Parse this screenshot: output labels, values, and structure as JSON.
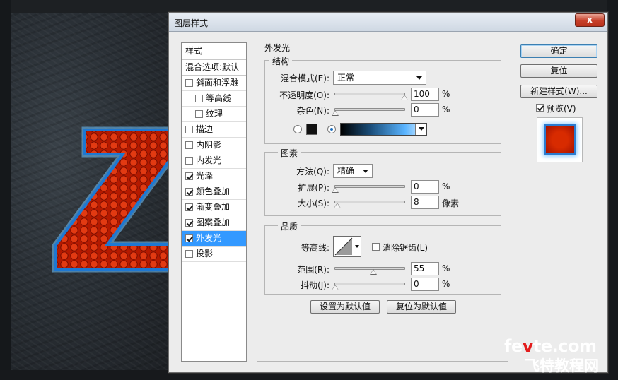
{
  "dialog": {
    "title": "图层样式",
    "close_label": "x"
  },
  "style_list": {
    "header": "样式",
    "blend_options": "混合选项:默认",
    "items": [
      {
        "label": "斜面和浮雕",
        "checked": false,
        "sub": false,
        "selected": false
      },
      {
        "label": "等高线",
        "checked": false,
        "sub": true,
        "selected": false
      },
      {
        "label": "纹理",
        "checked": false,
        "sub": true,
        "selected": false
      },
      {
        "label": "描边",
        "checked": false,
        "sub": false,
        "selected": false
      },
      {
        "label": "内阴影",
        "checked": false,
        "sub": false,
        "selected": false
      },
      {
        "label": "内发光",
        "checked": false,
        "sub": false,
        "selected": false
      },
      {
        "label": "光泽",
        "checked": true,
        "sub": false,
        "selected": false
      },
      {
        "label": "颜色叠加",
        "checked": true,
        "sub": false,
        "selected": false
      },
      {
        "label": "渐变叠加",
        "checked": true,
        "sub": false,
        "selected": false
      },
      {
        "label": "图案叠加",
        "checked": true,
        "sub": false,
        "selected": false
      },
      {
        "label": "外发光",
        "checked": true,
        "sub": false,
        "selected": true
      },
      {
        "label": "投影",
        "checked": false,
        "sub": false,
        "selected": false
      }
    ]
  },
  "outer_glow": {
    "title": "外发光",
    "structure": {
      "title": "结构",
      "blend_mode_label": "混合模式(E):",
      "blend_mode_value": "正常",
      "opacity_label": "不透明度(O):",
      "opacity_value": "100",
      "opacity_unit": "%",
      "opacity_fraction": 1.0,
      "noise_label": "杂色(N):",
      "noise_value": "0",
      "noise_unit": "%",
      "noise_fraction": 0.0,
      "color_mode": "gradient"
    },
    "elements": {
      "title": "图素",
      "technique_label": "方法(Q):",
      "technique_value": "精确",
      "spread_label": "扩展(P):",
      "spread_value": "0",
      "spread_unit": "%",
      "spread_fraction": 0.0,
      "size_label": "大小(S):",
      "size_value": "8",
      "size_unit": "像素",
      "size_fraction": 0.032
    },
    "quality": {
      "title": "品质",
      "contour_label": "等高线:",
      "antialias_label": "消除锯齿(L)",
      "antialias_checked": false,
      "range_label": "范围(R):",
      "range_value": "55",
      "range_unit": "%",
      "range_fraction": 0.55,
      "jitter_label": "抖动(J):",
      "jitter_value": "0",
      "jitter_unit": "%",
      "jitter_fraction": 0.0
    },
    "make_default_label": "设置为默认值",
    "reset_default_label": "复位为默认值"
  },
  "buttons": {
    "ok": "确定",
    "reset": "复位",
    "new_style": "新建样式(W)...",
    "preview_label": "预览(V)",
    "preview_checked": true
  },
  "watermark": {
    "domain_pre": "fe",
    "domain_v": "v",
    "domain_post": "te.com",
    "name": "飞特教程网"
  },
  "colors": {
    "accent": "#3399ff",
    "glow_color": "#5ab4ff",
    "swatch_color": "#111111"
  }
}
